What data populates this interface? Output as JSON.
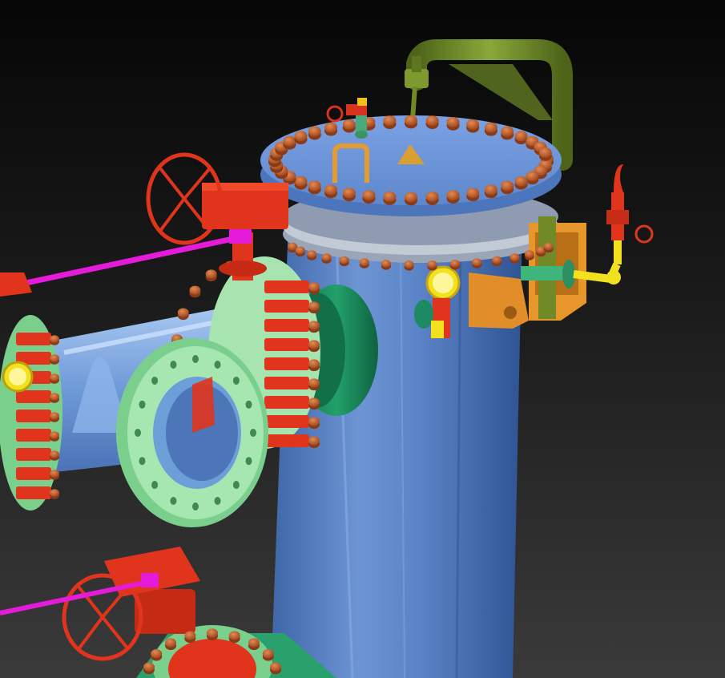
{
  "scene": {
    "kind": "3d-cad-render",
    "subject": "pipeline-filter-vessel-with-valves",
    "colors": {
      "vessel_body": "#5b86c9",
      "vessel_cover": "#6f95d8",
      "bolts": "#c8622f",
      "flange_green": "#8fd99a",
      "flange_dark_green": "#1b8a5a",
      "valve_red": "#e0351c",
      "stem_magenta": "#e41bd8",
      "vent_pipe": "#6f8a26",
      "bracket_orange": "#e6962b",
      "gauge_yellow": "#f2e21e"
    },
    "icons": [
      "handwheel-icon",
      "pressure-gauge-icon",
      "safety-valve-icon",
      "lifting-handle-icon"
    ]
  }
}
